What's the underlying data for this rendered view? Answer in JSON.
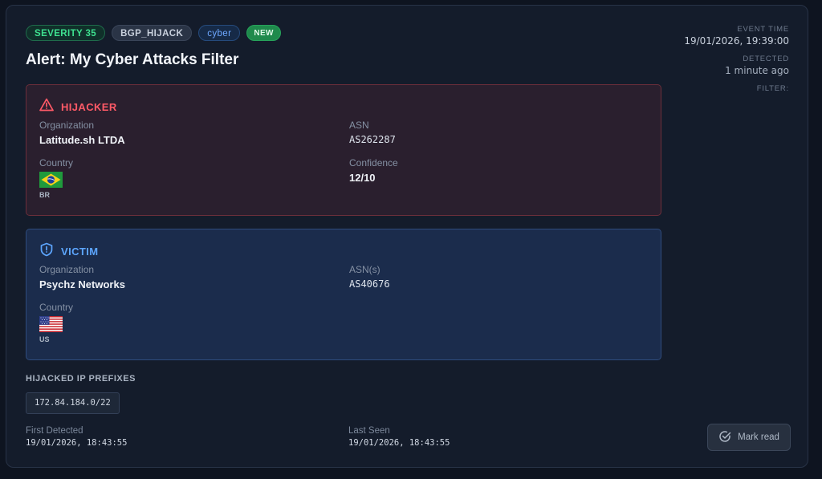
{
  "badges": {
    "severity": "SEVERITY 35",
    "type": "BGP_HIJACK",
    "tag": "cyber",
    "status": "NEW"
  },
  "title": "Alert: My Cyber Attacks Filter",
  "meta": {
    "event_time_label": "EVENT TIME",
    "event_time": "19/01/2026, 19:39:00",
    "detected_label": "DETECTED",
    "detected": "1 minute ago",
    "filter_label": "FILTER:"
  },
  "hijacker": {
    "heading": "HIJACKER",
    "org_label": "Organization",
    "org": "Latitude.sh LTDA",
    "asn_label": "ASN",
    "asn": "AS262287",
    "country_label": "Country",
    "country_code": "BR",
    "confidence_label": "Confidence",
    "confidence": "12/10"
  },
  "victim": {
    "heading": "VICTIM",
    "org_label": "Organization",
    "org": "Psychz Networks",
    "asn_label": "ASN(s)",
    "asn": "AS40676",
    "country_label": "Country",
    "country_code": "US"
  },
  "prefixes": {
    "label": "HIJACKED IP PREFIXES",
    "items": [
      "172.84.184.0/22"
    ]
  },
  "times": {
    "first_label": "First Detected",
    "first": "19/01/2026, 18:43:55",
    "last_label": "Last Seen",
    "last": "19/01/2026, 18:43:55"
  },
  "actions": {
    "mark_read": "Mark read"
  },
  "colors": {
    "hijacker_accent": "#ff5a67",
    "victim_accent": "#5da6ff",
    "severity_green": "#3ee08f"
  },
  "icons": {
    "hijacker": "warning-triangle-icon",
    "victim": "shield-alert-icon",
    "mark_read": "check-circle-icon"
  }
}
